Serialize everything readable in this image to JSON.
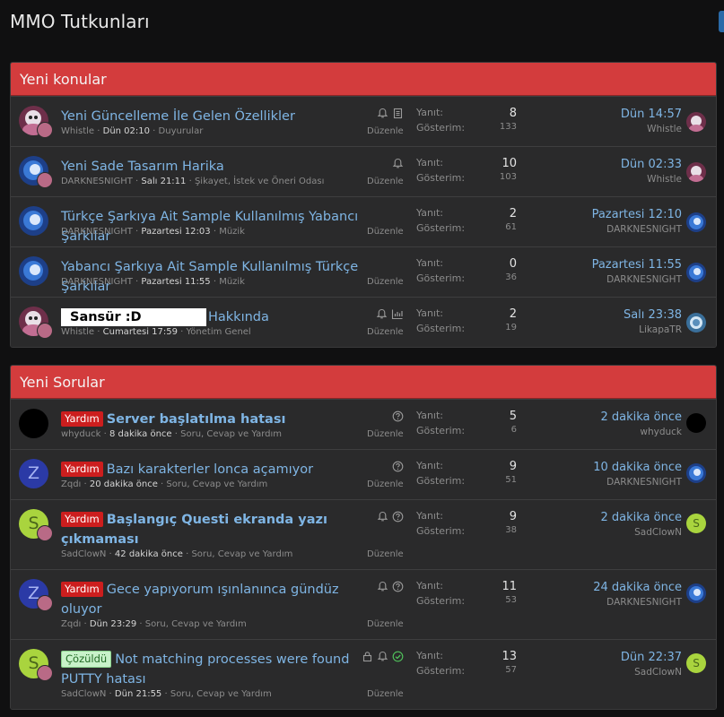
{
  "page_title": "MMO Tutkunları",
  "labels": {
    "yanit": "Yanıt:",
    "gosterim": "Gösterim:",
    "duzenle": "Düzenle"
  },
  "colors": {
    "header_red": "#d33c3d",
    "link_blue": "#7fb5e4",
    "prefix_red": "#cc1e1e",
    "prefix_green": "#c8f2c9"
  },
  "blocks": [
    {
      "title": "Yeni konular",
      "rows": [
        {
          "title": "Yeni Güncelleme İle Gelen Özellikler",
          "author": "Whistle",
          "date": "Dün 02:10",
          "forum": "Duyurular",
          "replies": "8",
          "views": "133",
          "last_date": "Dün 14:57",
          "last_user": "Whistle",
          "icons": [
            "bell-icon",
            "document-icon"
          ]
        },
        {
          "title": "Yeni Sade Tasarım Harika",
          "author": "DARKNESNIGHT",
          "date": "Salı 21:11",
          "forum": "Şikayet, İstek ve Öneri Odası",
          "replies": "10",
          "views": "103",
          "last_date": "Dün 02:33",
          "last_user": "Whistle",
          "icons": [
            "bell-icon"
          ]
        },
        {
          "title": "Türkçe Şarkıya Ait Sample Kullanılmış Yabancı Şarkılar",
          "author": "DARKNESNIGHT",
          "date": "Pazartesi 12:03",
          "forum": "Müzik",
          "replies": "2",
          "views": "61",
          "last_date": "Pazartesi 12:10",
          "last_user": "DARKNESNIGHT",
          "icons": []
        },
        {
          "title": "Yabancı Şarkıya Ait Sample Kullanılmış Türkçe Şarkılar",
          "author": "DARKNESNIGHT",
          "date": "Pazartesi 11:55",
          "forum": "Müzik",
          "replies": "0",
          "views": "36",
          "last_date": "Pazartesi 11:55",
          "last_user": "DARKNESNIGHT",
          "icons": []
        },
        {
          "censor": "Sansür :D",
          "title": "Hakkında",
          "author": "Whistle",
          "date": "Cumartesi 17:59",
          "forum": "Yönetim Genel",
          "replies": "2",
          "views": "19",
          "last_date": "Salı 23:38",
          "last_user": "LikapaTR",
          "icons": [
            "bell-icon",
            "chart-icon"
          ]
        }
      ]
    },
    {
      "title": "Yeni Sorular",
      "rows": [
        {
          "prefix": "Yardım",
          "title": "Server başlatılma hatası",
          "author": "whyduck",
          "date": "8 dakika önce",
          "forum": "Soru, Cevap ve Yardım",
          "replies": "5",
          "views": "6",
          "last_date": "2 dakika önce",
          "last_user": "whyduck",
          "icons": [
            "question-icon"
          ],
          "avatar_letter": ""
        },
        {
          "prefix": "Yardım",
          "title": "Bazı karakterler lonca açamıyor",
          "author": "Zqdı",
          "date": "20 dakika önce",
          "forum": "Soru, Cevap ve Yardım",
          "replies": "9",
          "views": "51",
          "last_date": "10 dakika önce",
          "last_user": "DARKNESNIGHT",
          "icons": [
            "question-icon"
          ],
          "avatar_letter": "Z"
        },
        {
          "prefix": "Yardım",
          "title": "Başlangıç Questi ekranda yazı çıkmaması",
          "author": "SadClowN",
          "date": "42 dakika önce",
          "forum": "Soru, Cevap ve Yardım",
          "replies": "9",
          "views": "38",
          "last_date": "2 dakika önce",
          "last_user": "SadClowN",
          "icons": [
            "bell-icon",
            "question-icon"
          ],
          "avatar_letter": "S",
          "last_letter": "S"
        },
        {
          "prefix": "Yardım",
          "title": "Gece yapıyorum ışınlanınca gündüz oluyor",
          "author": "Zqdı",
          "date": "Dün 23:29",
          "forum": "Soru, Cevap ve Yardım",
          "replies": "11",
          "views": "53",
          "last_date": "24 dakika önce",
          "last_user": "DARKNESNIGHT",
          "icons": [
            "bell-icon",
            "question-icon"
          ],
          "avatar_letter": "Z"
        },
        {
          "prefix": "Çözüldü",
          "title": "Not matching processes were found PUTTY hatası",
          "author": "SadClowN",
          "date": "Dün 21:55",
          "forum": "Soru, Cevap ve Yardım",
          "replies": "13",
          "views": "57",
          "last_date": "Dün 22:37",
          "last_user": "SadClowN",
          "icons": [
            "lock-icon",
            "bell-icon",
            "check-circle-icon"
          ],
          "avatar_letter": "S",
          "last_letter": "S"
        }
      ]
    }
  ]
}
